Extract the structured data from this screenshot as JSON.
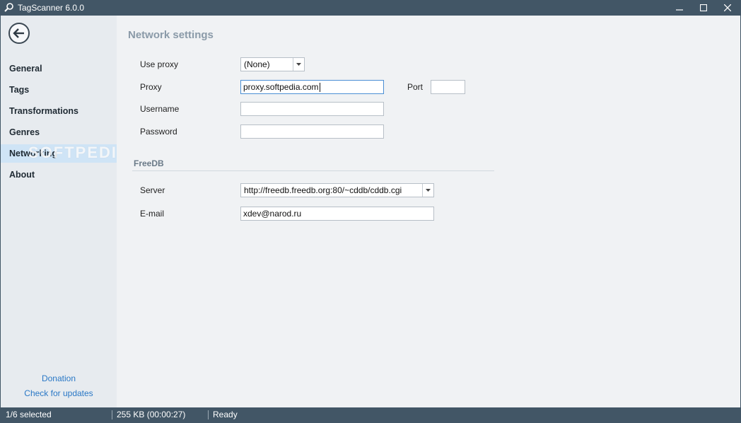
{
  "window": {
    "title": "TagScanner 6.0.0"
  },
  "sidebar": {
    "items": [
      {
        "label": "General"
      },
      {
        "label": "Tags"
      },
      {
        "label": "Transformations"
      },
      {
        "label": "Genres"
      },
      {
        "label": "Networking",
        "active": true
      },
      {
        "label": "About"
      }
    ],
    "donation_link": "Donation",
    "updates_link": "Check for updates"
  },
  "network": {
    "title": "Network settings",
    "use_proxy_label": "Use proxy",
    "use_proxy_value": "(None)",
    "proxy_label": "Proxy",
    "proxy_value": "proxy.softpedia.com",
    "port_label": "Port",
    "port_value": "",
    "username_label": "Username",
    "username_value": "",
    "password_label": "Password",
    "password_value": ""
  },
  "freedb": {
    "title": "FreeDB",
    "server_label": "Server",
    "server_value": "http://freedb.freedb.org:80/~cddb/cddb.cgi",
    "email_label": "E-mail",
    "email_value": "xdev@narod.ru"
  },
  "watermark": "SOFTPEDIA",
  "status": {
    "selected": "1/6 selected",
    "size": "255 KB (00:00:27)",
    "state": "Ready"
  },
  "colors": {
    "chrome": "#425666",
    "sidebar": "#e7ebef",
    "active_item": "#cfe4f6",
    "link": "#2a78c6"
  }
}
